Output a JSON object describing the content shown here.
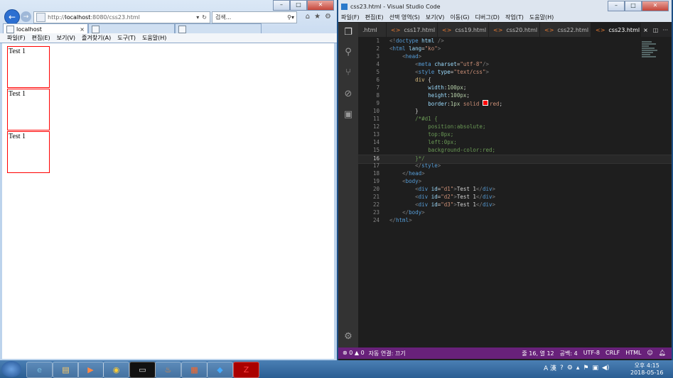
{
  "browser": {
    "url_prefix": "http://",
    "url_host": "localhost",
    "url_rest": ":8080/css23.html",
    "search_placeholder": "검색...",
    "tab_title": "localhost",
    "tab_close": "×",
    "menu": [
      "파일(F)",
      "편집(E)",
      "보기(V)",
      "즐겨찾기(A)",
      "도구(T)",
      "도움말(H)"
    ],
    "page_boxes": [
      "Test 1",
      "Test 1",
      "Test 1"
    ]
  },
  "vscode": {
    "title": "css23.html - Visual Studio Code",
    "menu": [
      "파일(F)",
      "편집(E)",
      "선택 영역(S)",
      "보기(V)",
      "이동(G)",
      "디버그(D)",
      "작업(T)",
      "도움말(H)"
    ],
    "tabs": [
      {
        "label": ".html",
        "icon": ""
      },
      {
        "label": "css17.html",
        "icon": "<>"
      },
      {
        "label": "css19.html",
        "icon": "<>"
      },
      {
        "label": "css20.html",
        "icon": "<>"
      },
      {
        "label": "css22.html",
        "icon": "<>"
      },
      {
        "label": "css23.html",
        "icon": "<>",
        "active": true
      }
    ],
    "current_line": 16,
    "status": {
      "problems": "⊗ 0 ▲ 0",
      "live": "자동 연결: 끄기",
      "position": "줄 16, 열 12",
      "spaces": "공백: 4",
      "encoding": "UTF-8",
      "eol": "CRLF",
      "language": "HTML"
    }
  },
  "taskbar": {
    "clock_time": "오후 4:15",
    "clock_date": "2018-05-16",
    "ime": "A 漢"
  },
  "colors": {
    "vscode_status": "#68217a",
    "box_border": "#ff0000"
  }
}
